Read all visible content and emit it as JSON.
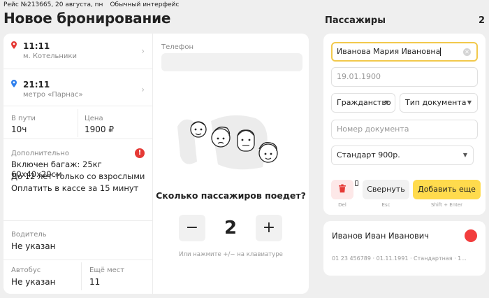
{
  "header": {
    "trip": "Рейс №213665, 20 августа, пн",
    "interface_mode": "Обычный интерфейс",
    "title": "Новое бронирование"
  },
  "route": {
    "departure": {
      "time": "11:11",
      "place": "м. Котельники",
      "pin_color": "#e53935"
    },
    "arrival": {
      "time": "21:11",
      "place": "метро «Парнас»",
      "pin_color": "#2f80ed"
    },
    "duration": {
      "label": "В пути",
      "value": "10ч"
    },
    "price": {
      "label": "Цена",
      "value": "1900 ₽"
    },
    "additional": {
      "label": "Дополнительно",
      "warning": "!",
      "lines": [
        "Включен багаж: 25кг 60х40х20см",
        "До 12 лет только со взрослыми",
        "Оплатить в кассе за 15 минут"
      ]
    },
    "driver": {
      "label": "Водитель",
      "value": "Не указан"
    },
    "bus": {
      "label": "Автобус",
      "value": "Не указан"
    },
    "seats": {
      "label": "Ещё мест",
      "value": "11"
    }
  },
  "booking": {
    "phone_label": "Телефон",
    "question": "Сколько пассажиров поедет?",
    "count": "2",
    "minus": "−",
    "plus": "+",
    "hint": "Или нажмите +/− на клавиатуре"
  },
  "passengers": {
    "title": "Пассажиры",
    "count": "2",
    "form": {
      "name_value": "Иванова Мария Ивановна",
      "birthdate_value": "19.01.1900",
      "citizenship_label": "Гражданство",
      "doc_type_label": "Тип документа",
      "doc_number_placeholder": "Номер документа",
      "tariff_label": "Стандарт 900р.",
      "collapse_label": "Свернуть",
      "add_label": "Добавить еще",
      "kbd_delete": "Del",
      "kbd_collapse": "Esc",
      "kbd_add": "Shift + Enter"
    },
    "saved": [
      {
        "name": "Иванов Иван Иванович",
        "info": "01 23 456789 · 01.11.1991 · Стандартная · 1..."
      }
    ]
  },
  "colors": {
    "accent": "#ffdb4d",
    "danger": "#f23d3d",
    "focus": "#f2c94c"
  }
}
